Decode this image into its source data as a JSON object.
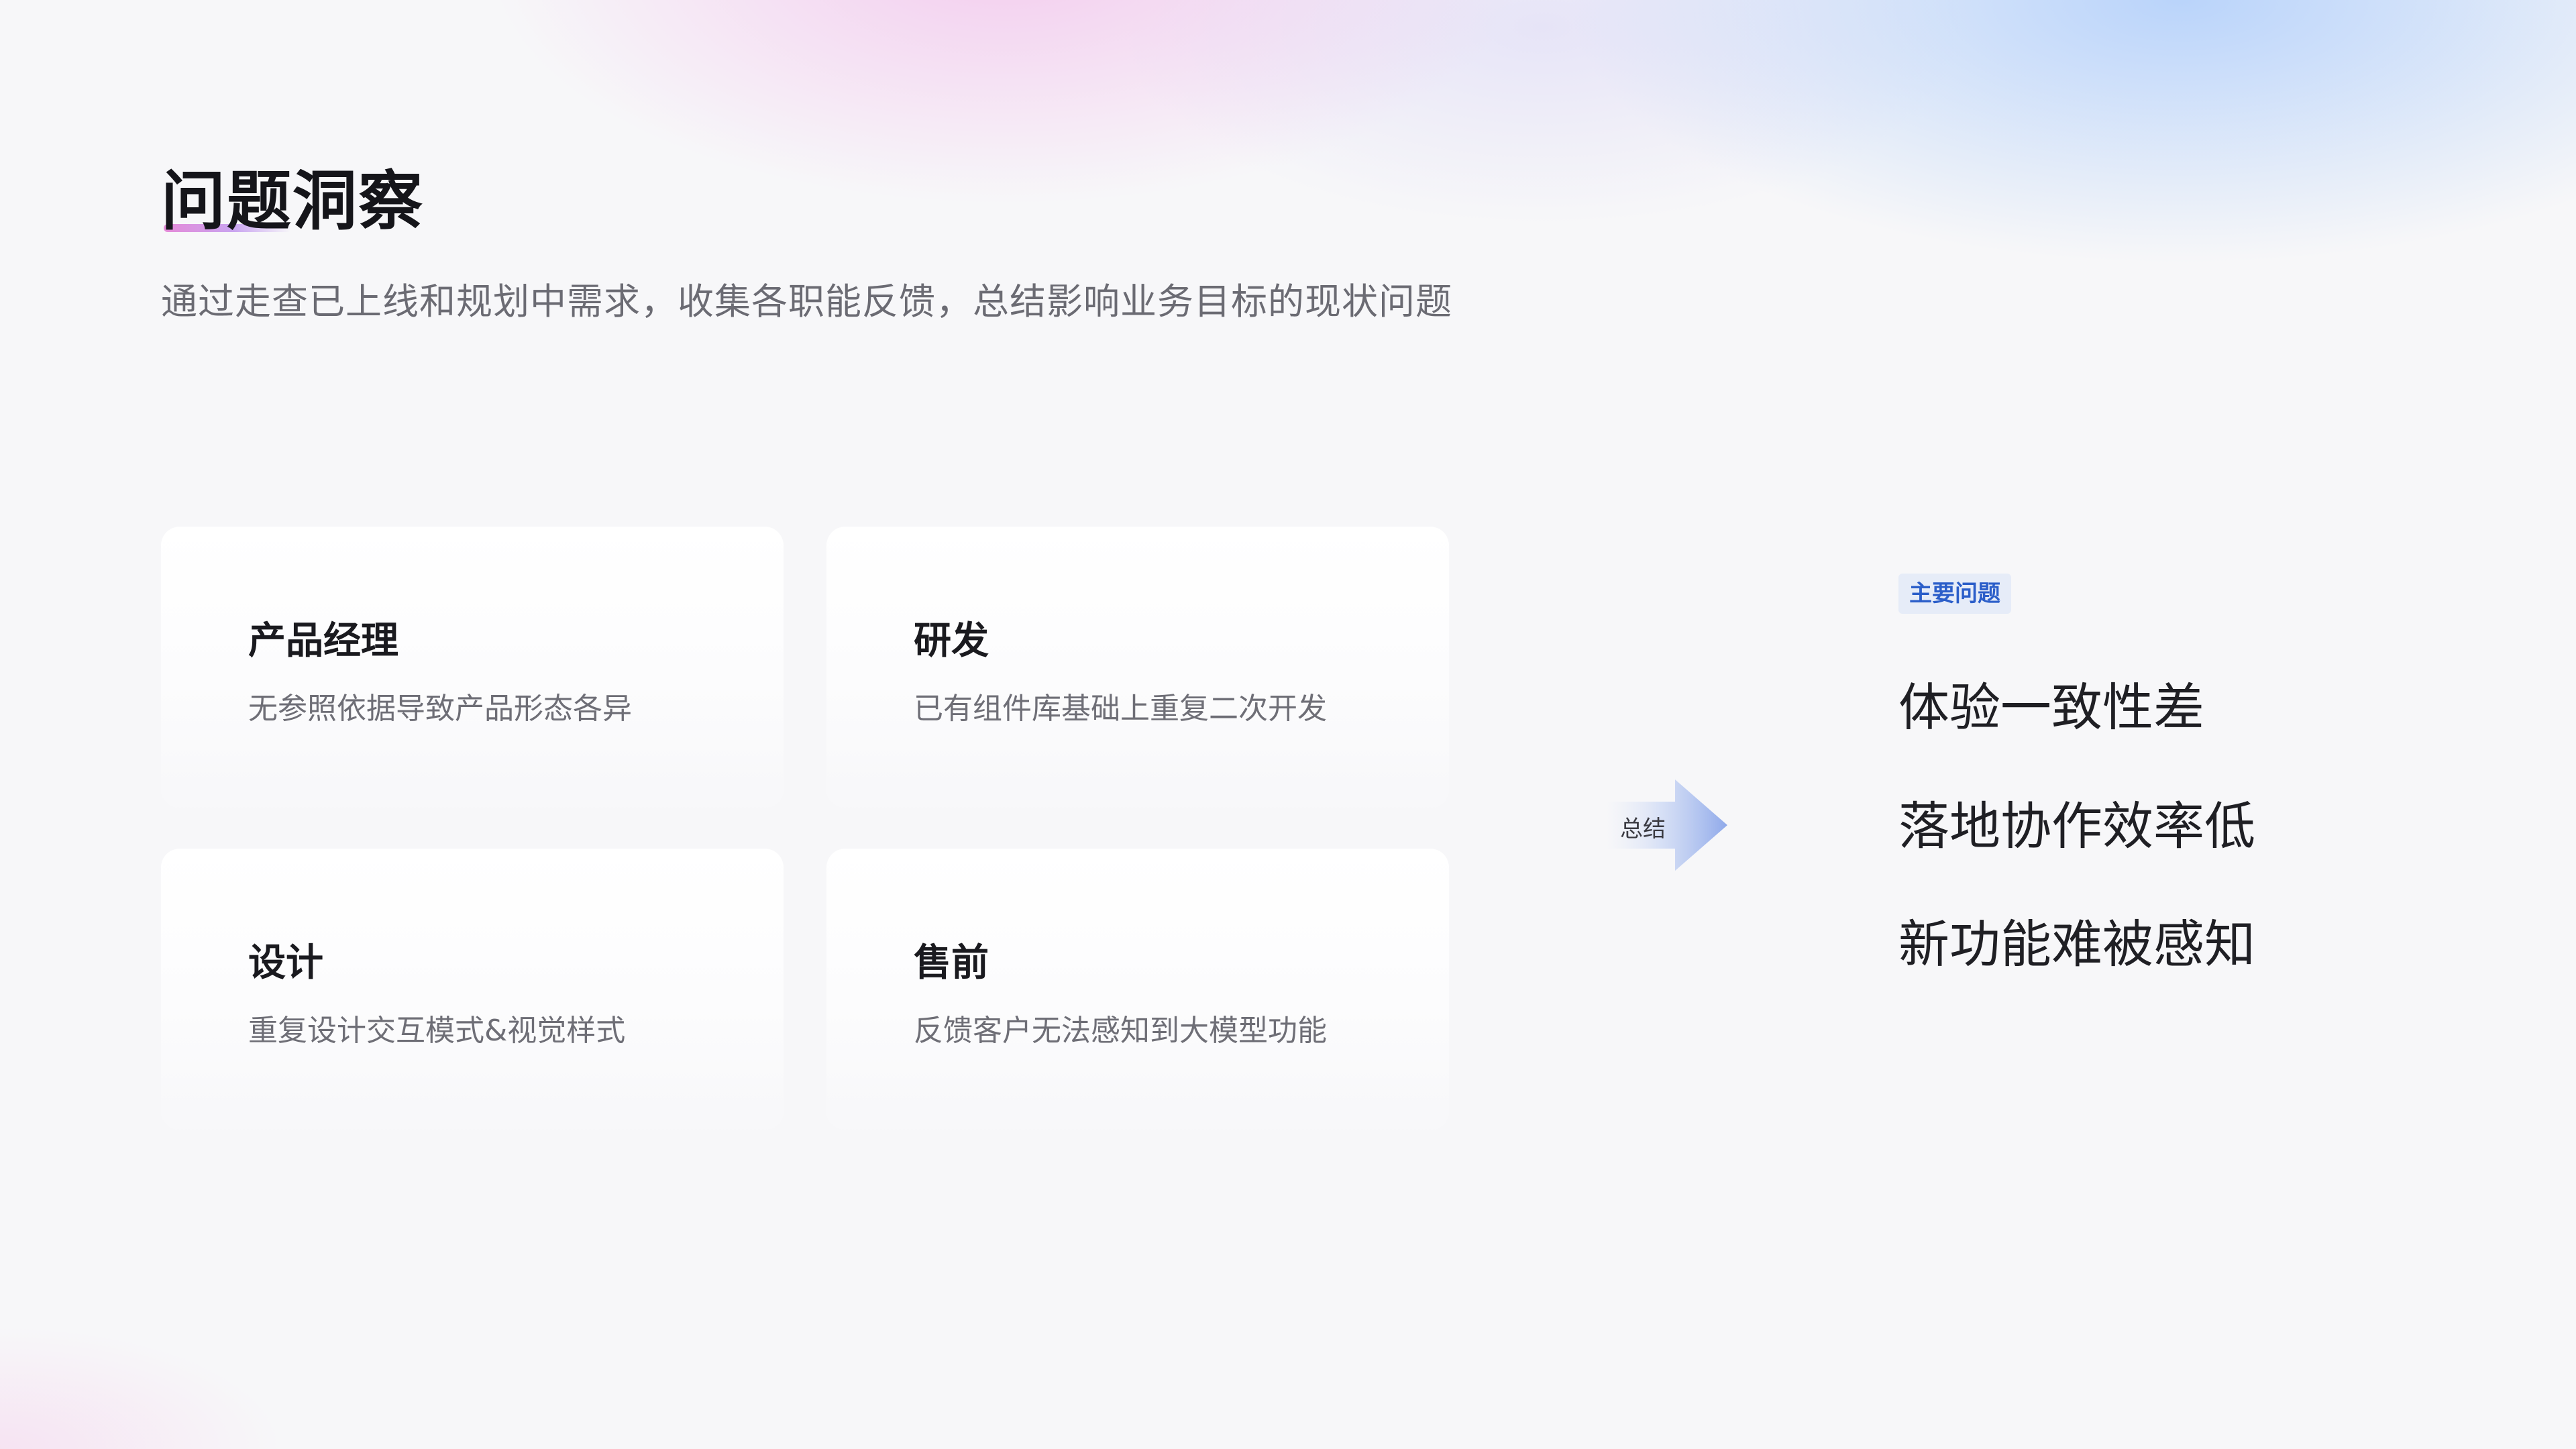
{
  "header": {
    "title": "问题洞察",
    "subtitle": "通过走查已上线和规划中需求，收集各职能反馈，总结影响业务目标的现状问题"
  },
  "cards": [
    {
      "title": "产品经理",
      "description": "无参照依据导致产品形态各异"
    },
    {
      "title": "研发",
      "description": "已有组件库基础上重复二次开发"
    },
    {
      "title": "设计",
      "description": "重复设计交互模式&视觉样式"
    },
    {
      "title": "售前",
      "description": "反馈客户无法感知到大模型功能"
    }
  ],
  "summary": {
    "label": "总结",
    "icon": "arrow-right-icon"
  },
  "main_issues": {
    "tag": "主要问题",
    "items": [
      "体验一致性差",
      "落地协作效率低",
      "新功能难被感知"
    ]
  },
  "colors": {
    "accent_blue": "#2b5ec9",
    "tag_bg": "#e6ecf8",
    "underline_pink": "#e58ad8"
  }
}
